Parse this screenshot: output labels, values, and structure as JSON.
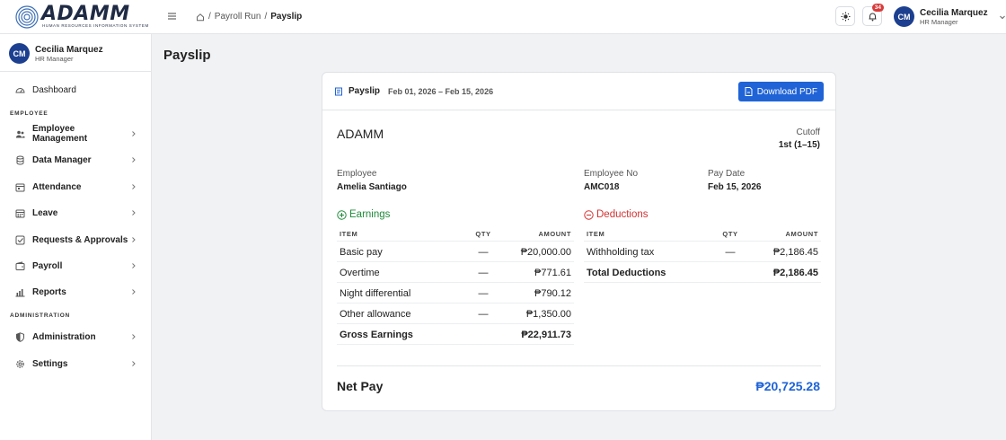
{
  "header": {
    "logo_text": "ADAMM",
    "logo_subtitle": "HUMAN RESOURCES INFORMATION SYSTEM",
    "breadcrumb": [
      "Payroll Run",
      "Payslip"
    ],
    "notification_count": "34",
    "user": {
      "initials": "CM",
      "name": "Cecilia Marquez",
      "role": "HR Manager"
    }
  },
  "sidebar": {
    "user": {
      "initials": "CM",
      "name": "Cecilia Marquez",
      "role": "HR Manager"
    },
    "dashboard": "Dashboard",
    "section_employee": "EMPLOYEE",
    "items": [
      {
        "label": "Employee Management",
        "icon": "users-icon"
      },
      {
        "label": "Data Manager",
        "icon": "database-icon"
      },
      {
        "label": "Attendance",
        "icon": "calendar-icon"
      },
      {
        "label": "Leave",
        "icon": "calendar-grid-icon"
      },
      {
        "label": "Requests & Approvals",
        "icon": "checkbox-icon"
      },
      {
        "label": "Payroll",
        "icon": "wallet-icon"
      },
      {
        "label": "Reports",
        "icon": "bar-chart-icon"
      }
    ],
    "section_admin": "ADMINISTRATION",
    "admin_items": [
      {
        "label": "Administration",
        "icon": "shield-icon"
      },
      {
        "label": "Settings",
        "icon": "gear-icon"
      }
    ]
  },
  "page": {
    "title": "Payslip"
  },
  "payslip": {
    "title": "Payslip",
    "period": "Feb 01, 2026 – Feb 15, 2026",
    "download_label": "Download PDF",
    "company": "ADAMM",
    "cutoff_label": "Cutoff",
    "cutoff_value": "1st (1–15)",
    "employee_label": "Employee",
    "employee_value": "Amelia Santiago",
    "employee_no_label": "Employee No",
    "employee_no_value": "AMC018",
    "pay_date_label": "Pay Date",
    "pay_date_value": "Feb 15, 2026",
    "columns": {
      "item": "ITEM",
      "qty": "QTY",
      "amount": "AMOUNT"
    },
    "earnings": {
      "title": "Earnings",
      "rows": [
        {
          "item": "Basic pay",
          "qty": "—",
          "amount": "₱20,000.00"
        },
        {
          "item": "Overtime",
          "qty": "—",
          "amount": "₱771.61"
        },
        {
          "item": "Night differential",
          "qty": "—",
          "amount": "₱790.12"
        },
        {
          "item": "Other allowance",
          "qty": "—",
          "amount": "₱1,350.00"
        }
      ],
      "total_label": "Gross Earnings",
      "total_amount": "₱22,911.73"
    },
    "deductions": {
      "title": "Deductions",
      "rows": [
        {
          "item": "Withholding tax",
          "qty": "—",
          "amount": "₱2,186.45"
        }
      ],
      "total_label": "Total Deductions",
      "total_amount": "₱2,186.45"
    },
    "net_pay_label": "Net Pay",
    "net_pay_value": "₱20,725.28"
  },
  "colors": {
    "accent": "#1f63d6",
    "earnings": "#1f8a3b",
    "deductions": "#d33131",
    "avatar": "#1c3f8f"
  }
}
